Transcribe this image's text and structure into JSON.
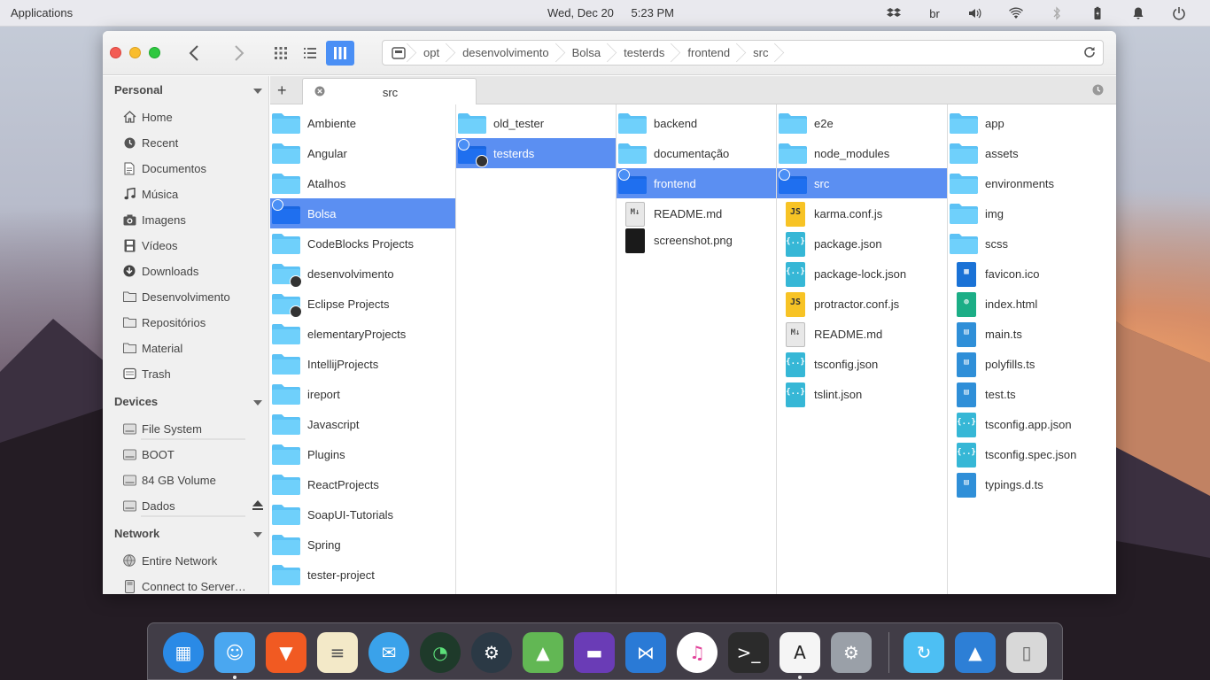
{
  "top_panel": {
    "applications": "Applications",
    "date": "Wed, Dec 20",
    "time": "5:23 PM",
    "keyboard_layout": "br",
    "tray_icons": [
      "dropbox-icon",
      "keyboard-layout",
      "volume-icon",
      "wifi-icon",
      "bluetooth-icon",
      "battery-icon",
      "notifications-icon",
      "power-icon"
    ]
  },
  "headerbar": {
    "breadcrumbs": [
      "opt",
      "desenvolvimento",
      "Bolsa",
      "testerds",
      "frontend",
      "src"
    ],
    "accent": "#4a8ff5"
  },
  "sidebar": {
    "personal_header": "Personal",
    "personal_items": [
      {
        "label": "Home",
        "icon": "home-icon"
      },
      {
        "label": "Recent",
        "icon": "clock-icon"
      },
      {
        "label": "Documentos",
        "icon": "document-icon"
      },
      {
        "label": "Música",
        "icon": "music-icon"
      },
      {
        "label": "Imagens",
        "icon": "camera-icon"
      },
      {
        "label": "Vídeos",
        "icon": "film-icon"
      },
      {
        "label": "Downloads",
        "icon": "download-icon"
      },
      {
        "label": "Desenvolvimento",
        "icon": "folder-icon"
      },
      {
        "label": "Repositórios",
        "icon": "folder-icon"
      },
      {
        "label": "Material",
        "icon": "folder-icon"
      },
      {
        "label": "Trash",
        "icon": "trash-icon"
      }
    ],
    "devices_header": "Devices",
    "device_items": [
      {
        "label": "File System",
        "icon": "drive-icon"
      },
      {
        "label": "BOOT",
        "icon": "drive-icon"
      },
      {
        "label": "84 GB Volume",
        "icon": "drive-icon"
      },
      {
        "label": "Dados",
        "icon": "drive-icon"
      }
    ],
    "network_header": "Network",
    "network_items": [
      {
        "label": "Entire Network",
        "icon": "network-icon"
      },
      {
        "label": "Connect to Server…",
        "icon": "server-icon"
      }
    ]
  },
  "tabs": {
    "active_tab": "src"
  },
  "columns": [
    {
      "items": [
        {
          "name": "Ambiente",
          "type": "folder"
        },
        {
          "name": "Angular",
          "type": "folder"
        },
        {
          "name": "Atalhos",
          "type": "folder"
        },
        {
          "name": "Bolsa",
          "type": "folder",
          "selected": true
        },
        {
          "name": "CodeBlocks Projects",
          "type": "folder"
        },
        {
          "name": "desenvolvimento",
          "type": "folder",
          "link": true
        },
        {
          "name": "Eclipse Projects",
          "type": "folder",
          "link": true
        },
        {
          "name": "elementaryProjects",
          "type": "folder"
        },
        {
          "name": "IntellijProjects",
          "type": "folder"
        },
        {
          "name": "ireport",
          "type": "folder"
        },
        {
          "name": "Javascript",
          "type": "folder"
        },
        {
          "name": "Plugins",
          "type": "folder"
        },
        {
          "name": "ReactProjects",
          "type": "folder"
        },
        {
          "name": "SoapUI-Tutorials",
          "type": "folder"
        },
        {
          "name": "Spring",
          "type": "folder"
        },
        {
          "name": "tester-project",
          "type": "folder"
        }
      ]
    },
    {
      "items": [
        {
          "name": "old_tester",
          "type": "folder"
        },
        {
          "name": "testerds",
          "type": "folder",
          "selected": true,
          "link": true
        }
      ]
    },
    {
      "items": [
        {
          "name": "backend",
          "type": "folder"
        },
        {
          "name": "documentação",
          "type": "folder"
        },
        {
          "name": "frontend",
          "type": "folder",
          "selected": true
        },
        {
          "name": "README.md",
          "type": "md"
        },
        {
          "name": "screenshot.png",
          "type": "png"
        }
      ]
    },
    {
      "items": [
        {
          "name": "e2e",
          "type": "folder"
        },
        {
          "name": "node_modules",
          "type": "folder"
        },
        {
          "name": "src",
          "type": "folder",
          "selected": true
        },
        {
          "name": "karma.conf.js",
          "type": "js"
        },
        {
          "name": "package.json",
          "type": "json"
        },
        {
          "name": "package-lock.json",
          "type": "json"
        },
        {
          "name": "protractor.conf.js",
          "type": "js"
        },
        {
          "name": "README.md",
          "type": "md"
        },
        {
          "name": "tsconfig.json",
          "type": "json"
        },
        {
          "name": "tslint.json",
          "type": "json"
        }
      ]
    },
    {
      "items": [
        {
          "name": "app",
          "type": "folder"
        },
        {
          "name": "assets",
          "type": "folder"
        },
        {
          "name": "environments",
          "type": "folder"
        },
        {
          "name": "img",
          "type": "folder"
        },
        {
          "name": "scss",
          "type": "folder"
        },
        {
          "name": "favicon.ico",
          "type": "ico"
        },
        {
          "name": "index.html",
          "type": "html"
        },
        {
          "name": "main.ts",
          "type": "ts"
        },
        {
          "name": "polyfills.ts",
          "type": "ts"
        },
        {
          "name": "test.ts",
          "type": "ts"
        },
        {
          "name": "tsconfig.app.json",
          "type": "json"
        },
        {
          "name": "tsconfig.spec.json",
          "type": "json"
        },
        {
          "name": "typings.d.ts",
          "type": "ts"
        }
      ]
    }
  ],
  "dock": {
    "items": [
      "multitasking-view",
      "finder",
      "brave-browser",
      "text-editor",
      "mail",
      "clock",
      "steam",
      "android-studio",
      "visual-studio",
      "vscode",
      "itunes",
      "terminal",
      "app-store",
      "system-settings",
      "downloads-folder",
      "photos",
      "trash"
    ]
  }
}
